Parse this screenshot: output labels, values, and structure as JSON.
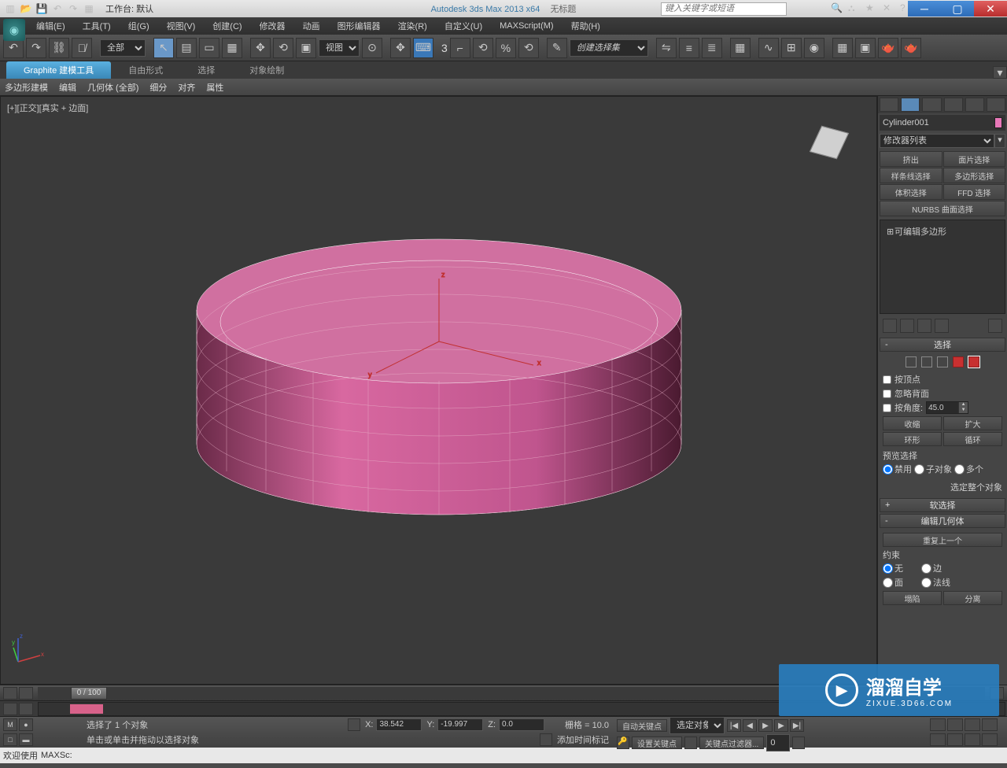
{
  "titlebar": {
    "workspace_label": "工作台: 默认",
    "app_title": "Autodesk 3ds Max  2013 x64",
    "doc_title": "无标题",
    "search_placeholder": "键入关键字或短语"
  },
  "menubar": {
    "items": [
      "编辑(E)",
      "工具(T)",
      "组(G)",
      "视图(V)",
      "创建(C)",
      "修改器",
      "动画",
      "图形编辑器",
      "渲染(R)",
      "自定义(U)",
      "MAXScript(M)",
      "帮助(H)"
    ]
  },
  "maintoolbar": {
    "filter_select": "全部",
    "refcoord_select": "视图",
    "angle_snap_value": "3",
    "named_sel_placeholder": "创建选择集"
  },
  "ribbon": {
    "tabs": [
      "Graphite 建模工具",
      "自由形式",
      "选择",
      "对象绘制"
    ],
    "active_tab": 0,
    "panels": [
      "多边形建模",
      "编辑",
      "几何体 (全部)",
      "细分",
      "对齐",
      "属性"
    ]
  },
  "viewport": {
    "label": "[+][正交][真实 + 边面]"
  },
  "cmdpanel": {
    "object_name": "Cylinder001",
    "modifier_list_label": "修改器列表",
    "mod_buttons": [
      "挤出",
      "面片选择",
      "样条线选择",
      "多边形选择",
      "体积选择",
      "FFD 选择"
    ],
    "mod_nurbs": "NURBS 曲面选择",
    "stack_item": "可编辑多边形",
    "rollouts": {
      "selection": {
        "title": "选择",
        "by_vertex": "按顶点",
        "ignore_backfacing": "忽略背面",
        "by_angle": "按角度:",
        "angle_value": "45.0",
        "shrink": "收缩",
        "grow": "扩大",
        "ring": "环形",
        "loop": "循环",
        "preview_label": "预览选择",
        "preview_opts": [
          "禁用",
          "子对象",
          "多个"
        ],
        "whole_object": "选定整个对象"
      },
      "soft_sel": {
        "title": "软选择"
      },
      "edit_geom": {
        "title": "编辑几何体",
        "repeat_last": "重复上一个",
        "constraints": "约束",
        "c_none": "无",
        "c_edge": "边",
        "c_face": "面",
        "c_normal": "法线",
        "collapse": "塌陷",
        "detach": "分离"
      }
    }
  },
  "timeline": {
    "slider_label": "0 / 100"
  },
  "status": {
    "selection_info": "选择了 1 个对象",
    "prompt": "单击或单击并拖动以选择对象",
    "x_label": "X:",
    "x_val": "38.542",
    "y_label": "Y:",
    "y_val": "-19.997",
    "z_label": "Z:",
    "z_val": "0.0",
    "grid_label": "栅格 = 10.0",
    "add_time_tag": "添加时间标记",
    "auto_key": "自动关键点",
    "set_key": "设置关键点",
    "sel_set": "选定对象",
    "key_filters": "关键点过滤器..."
  },
  "bottom": {
    "welcome": "欢迎使用",
    "script_label": "MAXSc:"
  },
  "watermark": {
    "main": "溜溜自学",
    "sub": "ZIXUE.3D66.COM"
  }
}
